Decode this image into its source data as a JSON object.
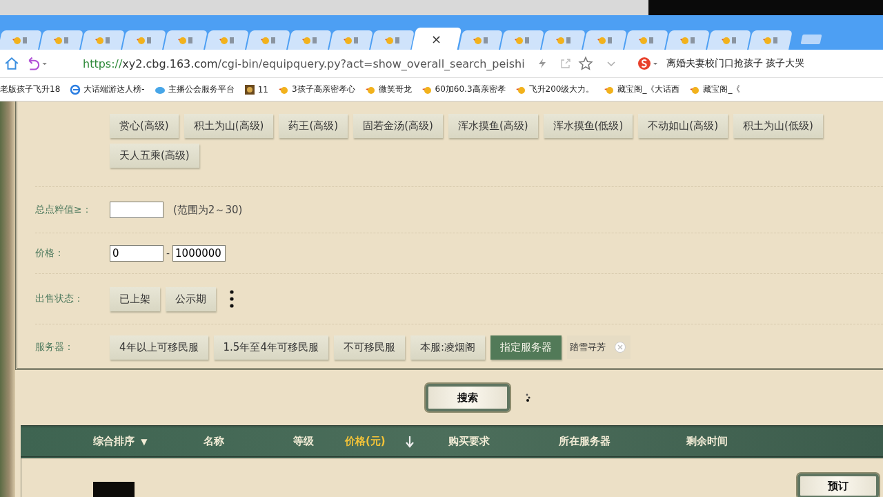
{
  "browser": {
    "tabs": [
      {
        "selected": false
      },
      {
        "selected": false
      },
      {
        "selected": false
      },
      {
        "selected": false
      },
      {
        "selected": false
      },
      {
        "selected": false
      },
      {
        "selected": false
      },
      {
        "selected": false
      },
      {
        "selected": false
      },
      {
        "selected": false
      },
      {
        "selected": true
      },
      {
        "selected": false
      },
      {
        "selected": false
      },
      {
        "selected": false
      },
      {
        "selected": false
      },
      {
        "selected": false
      },
      {
        "selected": false
      },
      {
        "selected": false
      },
      {
        "selected": false
      }
    ],
    "tab_close": "×",
    "address_bar": {
      "url": {
        "scheme": "https://",
        "host": "xy2.cbg.163.com",
        "path": "/cgi-bin/equipquery.py?act=show_overall_search_peishi"
      },
      "news_text": "离婚夫妻校门口抢孩子 孩子大哭"
    },
    "bookmarks": [
      {
        "kind": "plain",
        "label": "老版孩子飞升18"
      },
      {
        "kind": "browser",
        "label": "大话端游达人榜-"
      },
      {
        "kind": "cloud",
        "label": "主播公会服务平台"
      },
      {
        "kind": "game",
        "label": "11"
      },
      {
        "kind": "bird",
        "label": "3孩子高亲密孝心"
      },
      {
        "kind": "bird",
        "label": "微笑哥龙"
      },
      {
        "kind": "bird",
        "label": "60加60.3高亲密孝"
      },
      {
        "kind": "bird",
        "label": "飞升200级大力。"
      },
      {
        "kind": "bird",
        "label": "藏宝阁_《大话西"
      },
      {
        "kind": "bird",
        "label": "藏宝阁_《"
      }
    ]
  },
  "equip_effects": {
    "options": [
      {
        "label": "赏心(高级)",
        "selected": false
      },
      {
        "label": "积土为山(高级)",
        "selected": false
      },
      {
        "label": "药王(高级)",
        "selected": false
      },
      {
        "label": "固若金汤(高级)",
        "selected": false
      },
      {
        "label": "浑水摸鱼(高级)",
        "selected": false
      },
      {
        "label": "浑水摸鱼(低级)",
        "selected": false
      },
      {
        "label": "不动如山(高级)",
        "selected": false
      },
      {
        "label": "积土为山(低级)",
        "selected": false
      },
      {
        "label": "天人五乘(高级)",
        "selected": false
      }
    ]
  },
  "total_points": {
    "label": "总点粹值≥：",
    "hint": "(范围为2～30)"
  },
  "price": {
    "label": "价格：",
    "min": "0",
    "separator": "-",
    "max": "1000000"
  },
  "sale_status": {
    "label": "出售状态：",
    "options": [
      {
        "label": "已上架",
        "selected": false
      },
      {
        "label": "公示期",
        "selected": false
      }
    ]
  },
  "server": {
    "label": "服务器：",
    "options": [
      {
        "label": "4年以上可移民服",
        "selected": false
      },
      {
        "label": "1.5年至4年可移民服",
        "selected": false
      },
      {
        "label": "不可移民服",
        "selected": false
      },
      {
        "label": "本服:凌烟阁",
        "selected": false
      },
      {
        "label": "指定服务器",
        "selected": true
      }
    ],
    "chosen": "踏雪寻芳"
  },
  "search_button": "搜索",
  "results": {
    "columns": [
      {
        "kind": "dropdown",
        "label": "综合排序",
        "arrow": "▼",
        "selected": false
      },
      {
        "kind": "plain",
        "label": "名称",
        "selected": false
      },
      {
        "kind": "plain",
        "label": "等级",
        "selected": false
      },
      {
        "kind": "sortable",
        "label": "价格(元)",
        "selected": true
      },
      {
        "kind": "plain",
        "label": "购买要求",
        "selected": false
      },
      {
        "kind": "plain",
        "label": "所在服务器",
        "selected": false
      },
      {
        "kind": "plain",
        "label": "剩余时间",
        "selected": false
      }
    ],
    "rows": [
      {
        "action": "预订"
      }
    ]
  }
}
